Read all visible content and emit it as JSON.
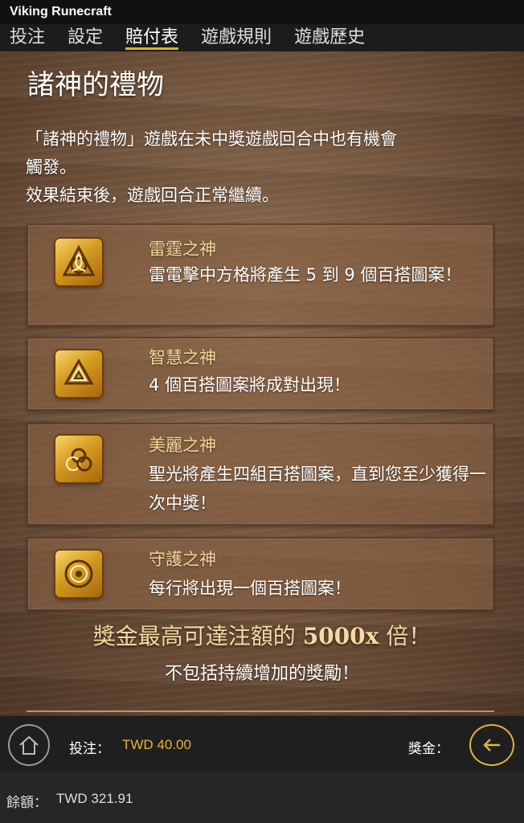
{
  "app": {
    "title": "Viking Runecraft"
  },
  "tabs": [
    {
      "label": "投注",
      "active": false
    },
    {
      "label": "設定",
      "active": false
    },
    {
      "label": "賠付表",
      "active": true
    },
    {
      "label": "遊戲規則",
      "active": false
    },
    {
      "label": "遊戲歷史",
      "active": false
    }
  ],
  "page": {
    "heading": "諸神的禮物",
    "intro_line1": "「諸神的禮物」遊戲在未中獎遊戲回合中也有機會",
    "intro_line2": "觸發。",
    "intro_line3": "效果結束後，遊戲回合正常繼續。"
  },
  "gods": [
    {
      "name": "雷霆之神",
      "desc": "雷電擊中方格將產生 5 到 9 個百搭圖案！",
      "icon": "triquetra-icon"
    },
    {
      "name": "智慧之神",
      "desc": "4 個百搭圖案將成對出現！",
      "icon": "valknut-icon"
    },
    {
      "name": "美麗之神",
      "desc": "聖光將產生四組百搭圖案，直到您至少獲得一次中獎！",
      "icon": "triple-horn-icon"
    },
    {
      "name": "守護之神",
      "desc": "每行將出現一個百搭圖案！",
      "icon": "shield-rings-icon"
    }
  ],
  "max_win": {
    "prefix": "獎金最高可達注額的",
    "multiplier": "5000x",
    "suffix": "倍！"
  },
  "max_win_note": "不包括持續增加的獎勵！",
  "footer": {
    "bet_label": "投注：",
    "bet_value": "TWD 40.00",
    "win_label": "獎金：",
    "balance_label": "餘額：",
    "balance_value": "TWD 321.91"
  },
  "colors": {
    "accent": "#e3b43c",
    "god_name": "#f1d99a"
  }
}
